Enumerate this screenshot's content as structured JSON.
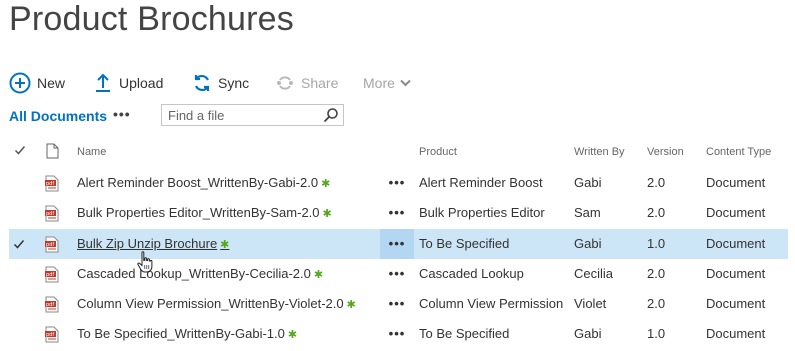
{
  "page": {
    "title": "Product Brochures"
  },
  "toolbar": {
    "new_label": "New",
    "upload_label": "Upload",
    "sync_label": "Sync",
    "share_label": "Share",
    "more_label": "More"
  },
  "views": {
    "all_documents": "All Documents",
    "more_views": "•••",
    "search_placeholder": "Find a file"
  },
  "columns": {
    "name": "Name",
    "product": "Product",
    "written_by": "Written By",
    "version": "Version",
    "content_type": "Content Type"
  },
  "rows": [
    {
      "name": "Alert Reminder Boost_WrittenBy-Gabi-2.0",
      "product": "Alert Reminder Boost",
      "written_by": "Gabi",
      "version": "2.0",
      "content_type": "Document",
      "new_badge": "✱",
      "menu": "•••"
    },
    {
      "name": "Bulk Properties Editor_WrittenBy-Sam-2.0",
      "product": "Bulk Properties Editor",
      "written_by": "Sam",
      "version": "2.0",
      "content_type": "Document",
      "new_badge": "✱",
      "menu": "•••"
    },
    {
      "name": "Bulk Zip Unzip Brochure",
      "product": "To Be Specified",
      "written_by": "Gabi",
      "version": "1.0",
      "content_type": "Document",
      "new_badge": "✱",
      "menu": "•••",
      "selected": true
    },
    {
      "name": "Cascaded Lookup_WrittenBy-Cecilia-2.0",
      "product": "Cascaded Lookup",
      "written_by": "Cecilia",
      "version": "2.0",
      "content_type": "Document",
      "new_badge": "✱",
      "menu": "•••"
    },
    {
      "name": "Column View Permission_WrittenBy-Violet-2.0",
      "product": "Column View Permission",
      "written_by": "Violet",
      "version": "2.0",
      "content_type": "Document",
      "new_badge": "✱",
      "menu": "•••"
    },
    {
      "name": "To Be Specified_WrittenBy-Gabi-1.0",
      "product": "To Be Specified",
      "written_by": "Gabi",
      "version": "1.0",
      "content_type": "Document",
      "new_badge": "✱",
      "menu": "•••"
    }
  ],
  "colors": {
    "accent": "#0072c6",
    "selected_row": "#cde6f7",
    "new_badge": "#55a71e",
    "pdf_icon": "#c0392b"
  },
  "icons": {
    "new": "plus-circle-icon",
    "upload": "upload-arrow-icon",
    "sync": "sync-icon",
    "share": "share-icon",
    "more": "chevron-down-icon",
    "search": "search-icon",
    "file_type": "pdf-icon",
    "select_all": "check-icon",
    "doc_type_header": "document-icon"
  }
}
